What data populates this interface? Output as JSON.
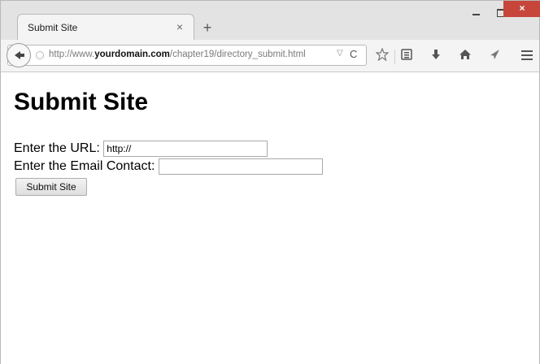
{
  "tab": {
    "title": "Submit Site",
    "close_glyph": "×",
    "new_tab_glyph": "+"
  },
  "window_controls": {
    "close_glyph": "×"
  },
  "address_bar": {
    "url_prefix": "http://www.",
    "url_domain": "yourdomain.com",
    "url_path": "/chapter19/directory_submit.html",
    "dropdown_glyph": "▽",
    "reload_glyph": "C"
  },
  "toolbar_icons": [
    "bookmark-star-icon",
    "reading-list-icon",
    "download-icon",
    "home-icon",
    "send-icon",
    "menu-icon"
  ],
  "page": {
    "heading": "Submit Site",
    "url_label": "Enter the URL:",
    "url_value": "http://",
    "email_label": "Enter the Email Contact:",
    "email_value": "",
    "submit_label": "Submit Site"
  }
}
